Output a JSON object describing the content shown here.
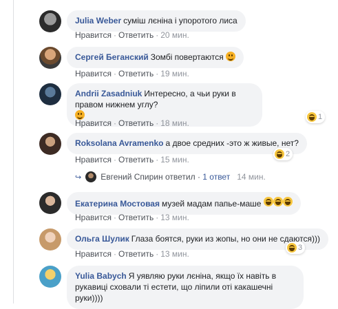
{
  "actions": {
    "like": "Нравится",
    "reply": "Ответить",
    "sep": "·"
  },
  "comments": [
    {
      "author": "Julia Weber",
      "text": "суміш лєніна і упоротого лиса",
      "time": "20 мин."
    },
    {
      "author": "Сергей Беганский",
      "text": "Зомбі повертаются",
      "time": "19 мин.",
      "emoji": "smile-emoji"
    },
    {
      "author": "Andrii Zasadniuk",
      "text": "Интересно, а чьи руки в правом нижнем углу?",
      "time": "18 мин.",
      "emoji": "smile-emoji",
      "reaction_count": "1"
    },
    {
      "author": "Roksolana Avramenko",
      "text": "а двое средних -это ж живые, нет?",
      "time": "15 мин.",
      "reaction_count": "2"
    },
    {
      "author": "Екатерина Мостовая",
      "text": "музей мадам папье-маше",
      "time": "13 мин.",
      "emoji_count": 3
    },
    {
      "author": "Ольга Шулик",
      "text": "Глаза боятся, руки из жопы, но они не сдаются)))",
      "time": "13 мин.",
      "reaction_count": "3"
    },
    {
      "author": "Yulia Babych",
      "text": "Я уявляю руки лєніна, якщо їх навіть в рукавиці сховали ті естети, що ліпили оті какашечні руки))))"
    }
  ],
  "reply": {
    "author": "Евгений Спирин",
    "verb": "ответил",
    "sep": "·",
    "count": "1 ответ",
    "time": "14 мин."
  }
}
